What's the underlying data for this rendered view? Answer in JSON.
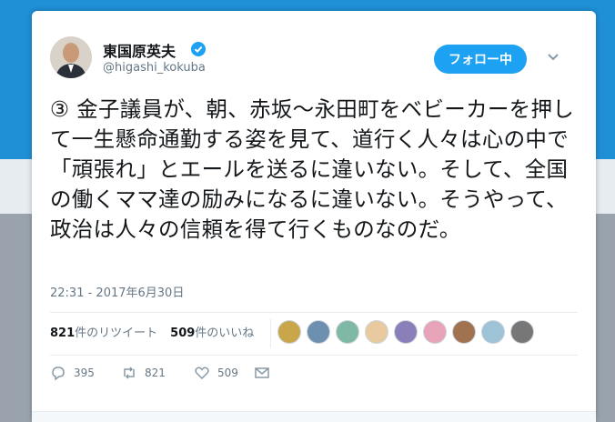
{
  "user": {
    "name": "東国原英夫",
    "handle": "@higashi_kokuba",
    "verified_icon": "verified-badge-icon",
    "avatar_icon": "user-avatar"
  },
  "follow_button": {
    "label": "フォロー中"
  },
  "tweet": {
    "text": "③ 金子議員が、朝、赤坂〜永田町をベビーカーを押して一生懸命通勤する姿を見て、道行く人々は心の中で「頑張れ」とエールを送るに違いない。そして、全国の働くママ達の励みになるに違いない。そうやって、政治は人々の信頼を得て行くものなのだ。",
    "timestamp": "22:31 - 2017年6月30日"
  },
  "stats": {
    "retweets_count": "821",
    "retweets_label": "件のリツイート",
    "likes_count": "509",
    "likes_label": "件のいいね"
  },
  "liker_avatars": [
    "#c9a64a",
    "#6d8fb0",
    "#7fb8a4",
    "#e8c9a0",
    "#8a7fb8",
    "#e7a4b8",
    "#a07250",
    "#9ec2d6",
    "#777"
  ],
  "actions": {
    "reply_count": "395",
    "retweet_count": "821",
    "like_count": "509"
  },
  "colors": {
    "accent": "#1da1f2",
    "text": "#14171a",
    "muted": "#657786"
  }
}
